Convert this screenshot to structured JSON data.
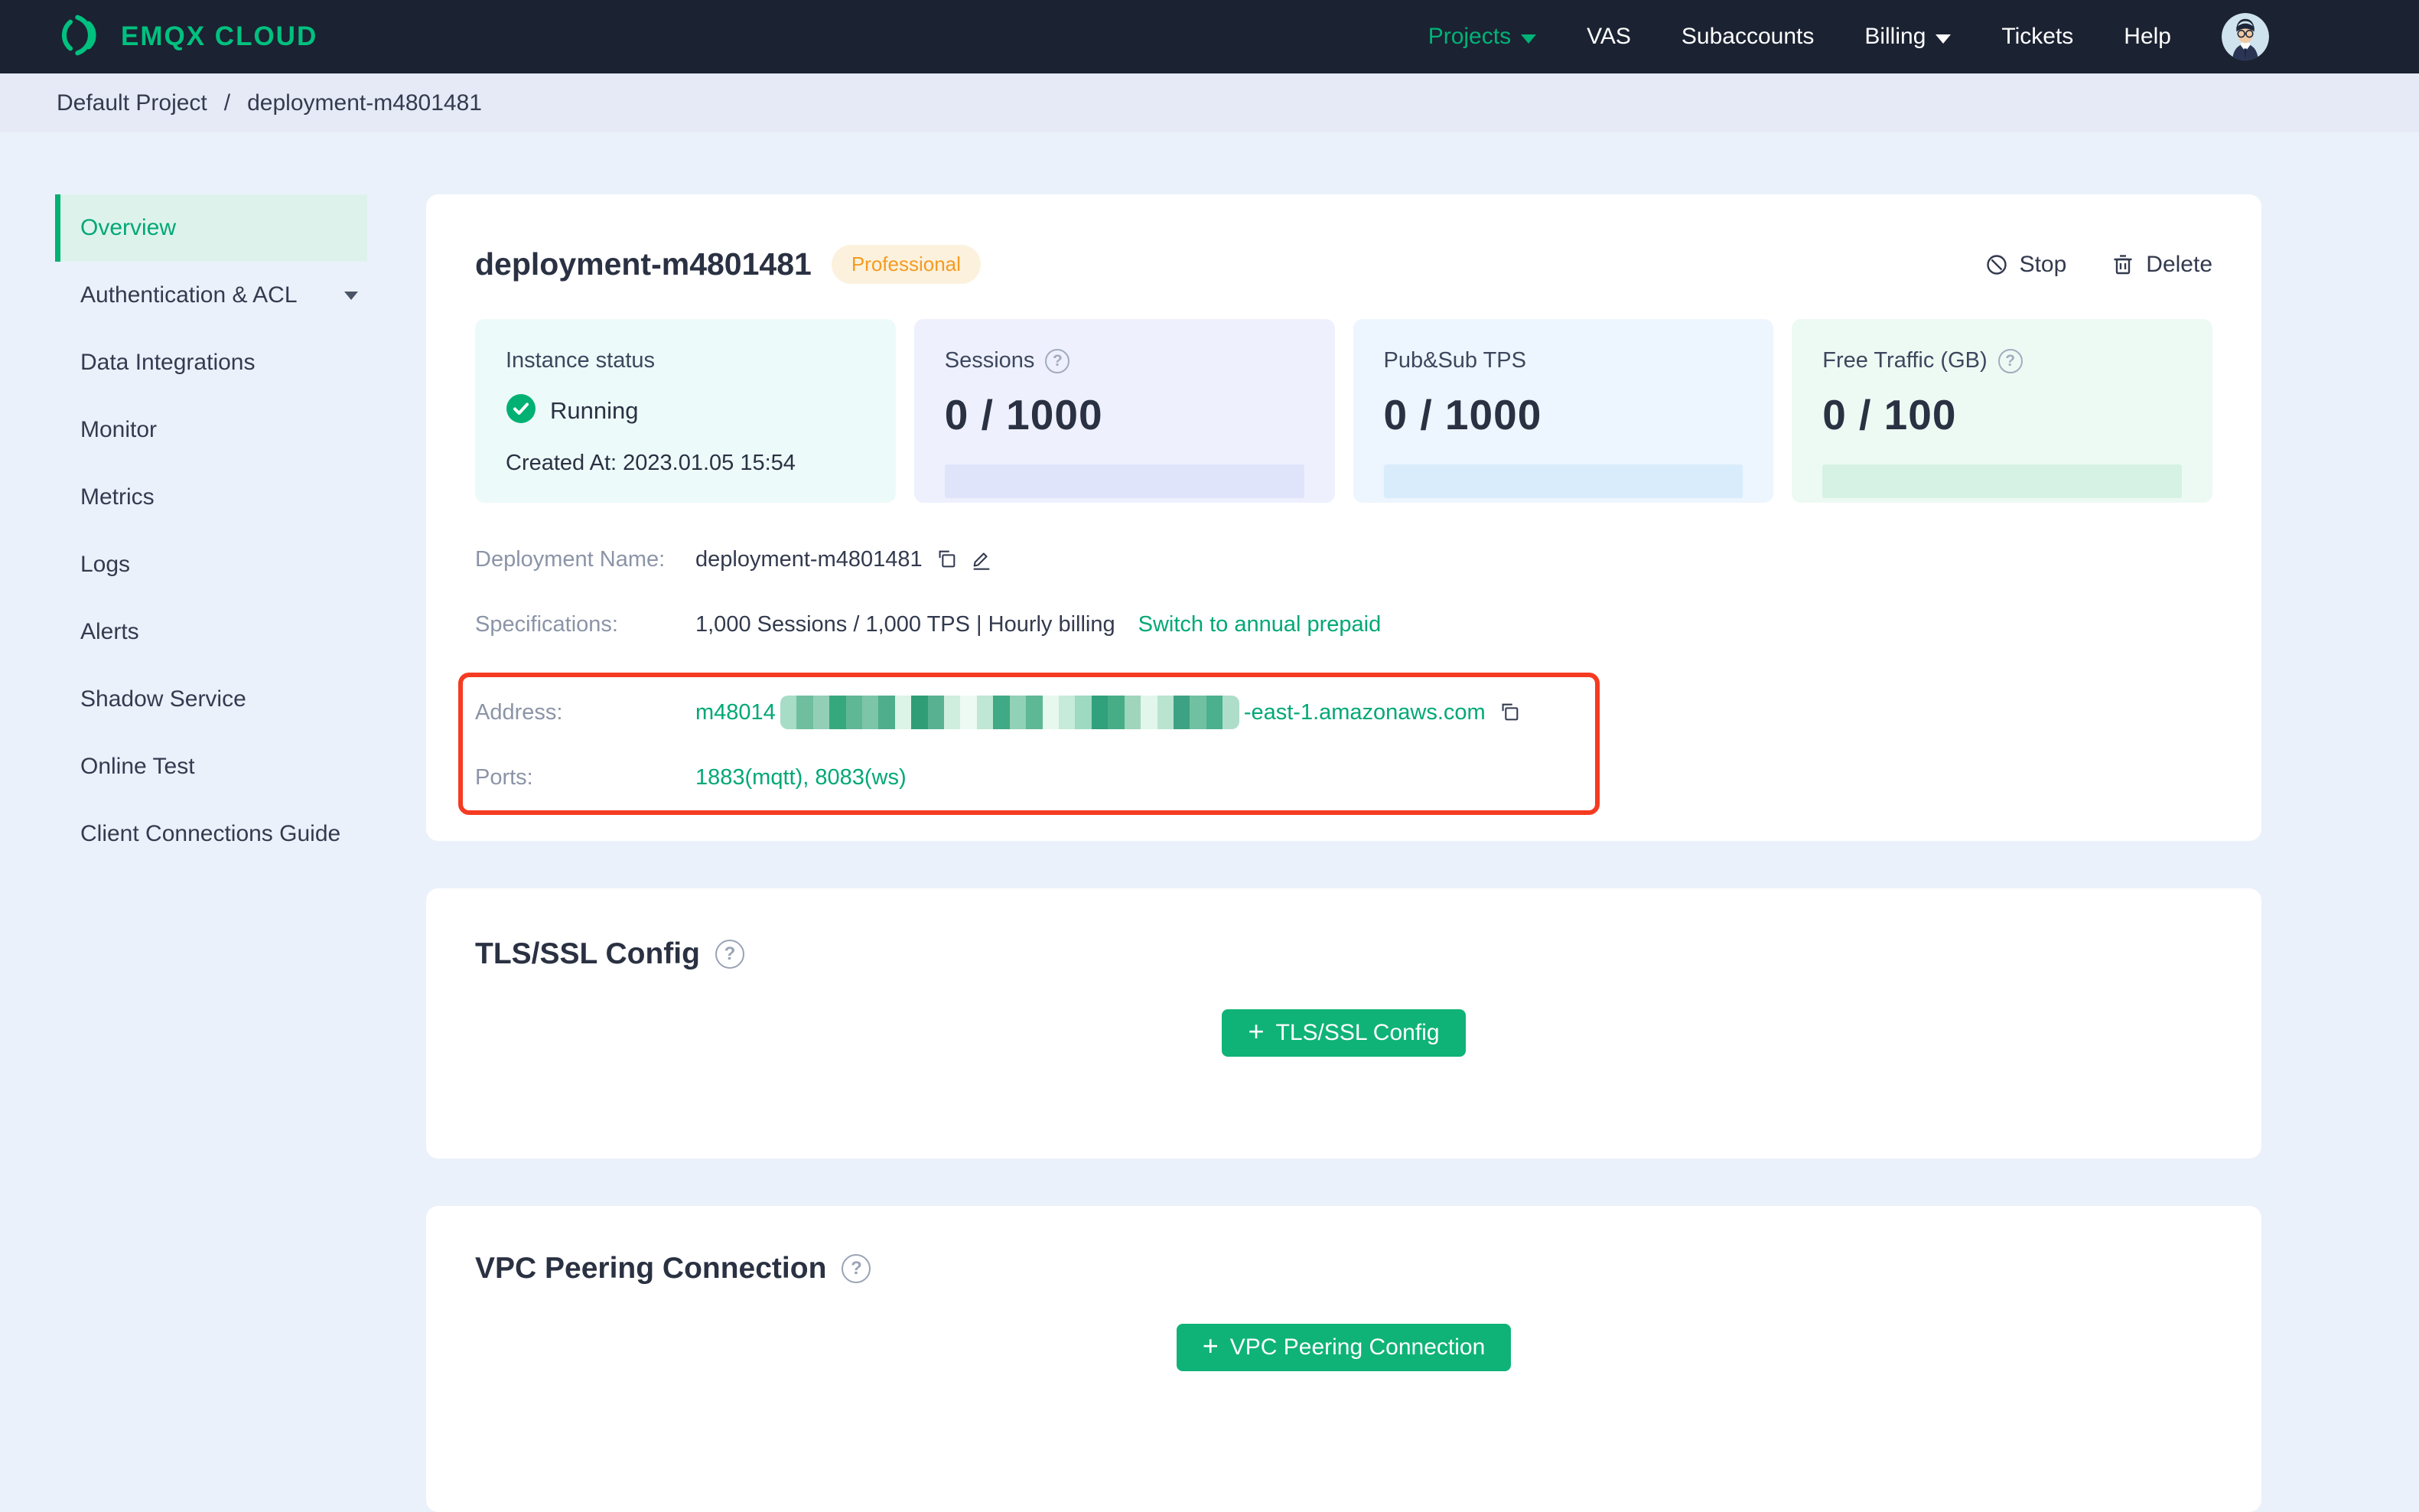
{
  "nav": {
    "brand": "EMQX CLOUD",
    "projects": "Projects",
    "vas": "VAS",
    "subaccounts": "Subaccounts",
    "billing": "Billing",
    "tickets": "Tickets",
    "help": "Help"
  },
  "breadcrumb": {
    "project": "Default Project",
    "separator": "/",
    "deployment": "deployment-m4801481"
  },
  "sidebar": {
    "items": [
      {
        "label": "Overview"
      },
      {
        "label": "Authentication & ACL"
      },
      {
        "label": "Data Integrations"
      },
      {
        "label": "Monitor"
      },
      {
        "label": "Metrics"
      },
      {
        "label": "Logs"
      },
      {
        "label": "Alerts"
      },
      {
        "label": "Shadow Service"
      },
      {
        "label": "Online Test"
      },
      {
        "label": "Client Connections Guide"
      }
    ]
  },
  "overview": {
    "title": "deployment-m4801481",
    "badge": "Professional",
    "actions": {
      "stop": "Stop",
      "delete": "Delete"
    },
    "stats": {
      "instance": {
        "label": "Instance status",
        "status": "Running",
        "created_at": "Created At: 2023.01.05 15:54"
      },
      "sessions": {
        "label": "Sessions",
        "value": "0 / 1000",
        "help": "?"
      },
      "tps": {
        "label": "Pub&Sub TPS",
        "value": "0 / 1000"
      },
      "traffic": {
        "label": "Free Traffic (GB)",
        "value": "0 / 100",
        "help": "?"
      }
    },
    "details": {
      "name_label": "Deployment Name:",
      "name_value": "deployment-m4801481",
      "spec_label": "Specifications:",
      "spec_value": "1,000 Sessions / 1,000 TPS | Hourly billing",
      "spec_link": "Switch to annual prepaid",
      "address_label": "Address:",
      "address_prefix": "m48014",
      "address_suffix": "-east-1.amazonaws.com",
      "address_redaction_blocks": [
        "#a7dcc6",
        "#6fbf9f",
        "#93cfb7",
        "#36a87e",
        "#60b795",
        "#7cc5a9",
        "#4fae8b",
        "#dcf3e8",
        "#2f9e77",
        "#58b292",
        "#cfeede",
        "#ecfaf3",
        "#bfe7d4",
        "#40a986",
        "#91d1b7",
        "#5db894",
        "#e7f8ef",
        "#c6ebd8",
        "#9ed9c1",
        "#31a07c",
        "#47ad86",
        "#9ed5bb",
        "#e2f6ec",
        "#b9e4d0",
        "#3da283",
        "#70c1a2",
        "#4bb08d",
        "#aedec9"
      ],
      "ports_label": "Ports:",
      "ports_value": "1883(mqtt), 8083(ws)"
    }
  },
  "tls": {
    "title": "TLS/SSL Config",
    "help": "?",
    "button": "TLS/SSL Config"
  },
  "vpc": {
    "title": "VPC Peering Connection",
    "help": "?",
    "button": "VPC Peering Connection"
  },
  "colors": {
    "brand_green": "#00b173",
    "link_green": "#00a875",
    "badge_orange": "#f59b22",
    "badge_bg": "#fcf1dd",
    "annotation_red": "#f53b21",
    "status_green": "#00b173"
  }
}
